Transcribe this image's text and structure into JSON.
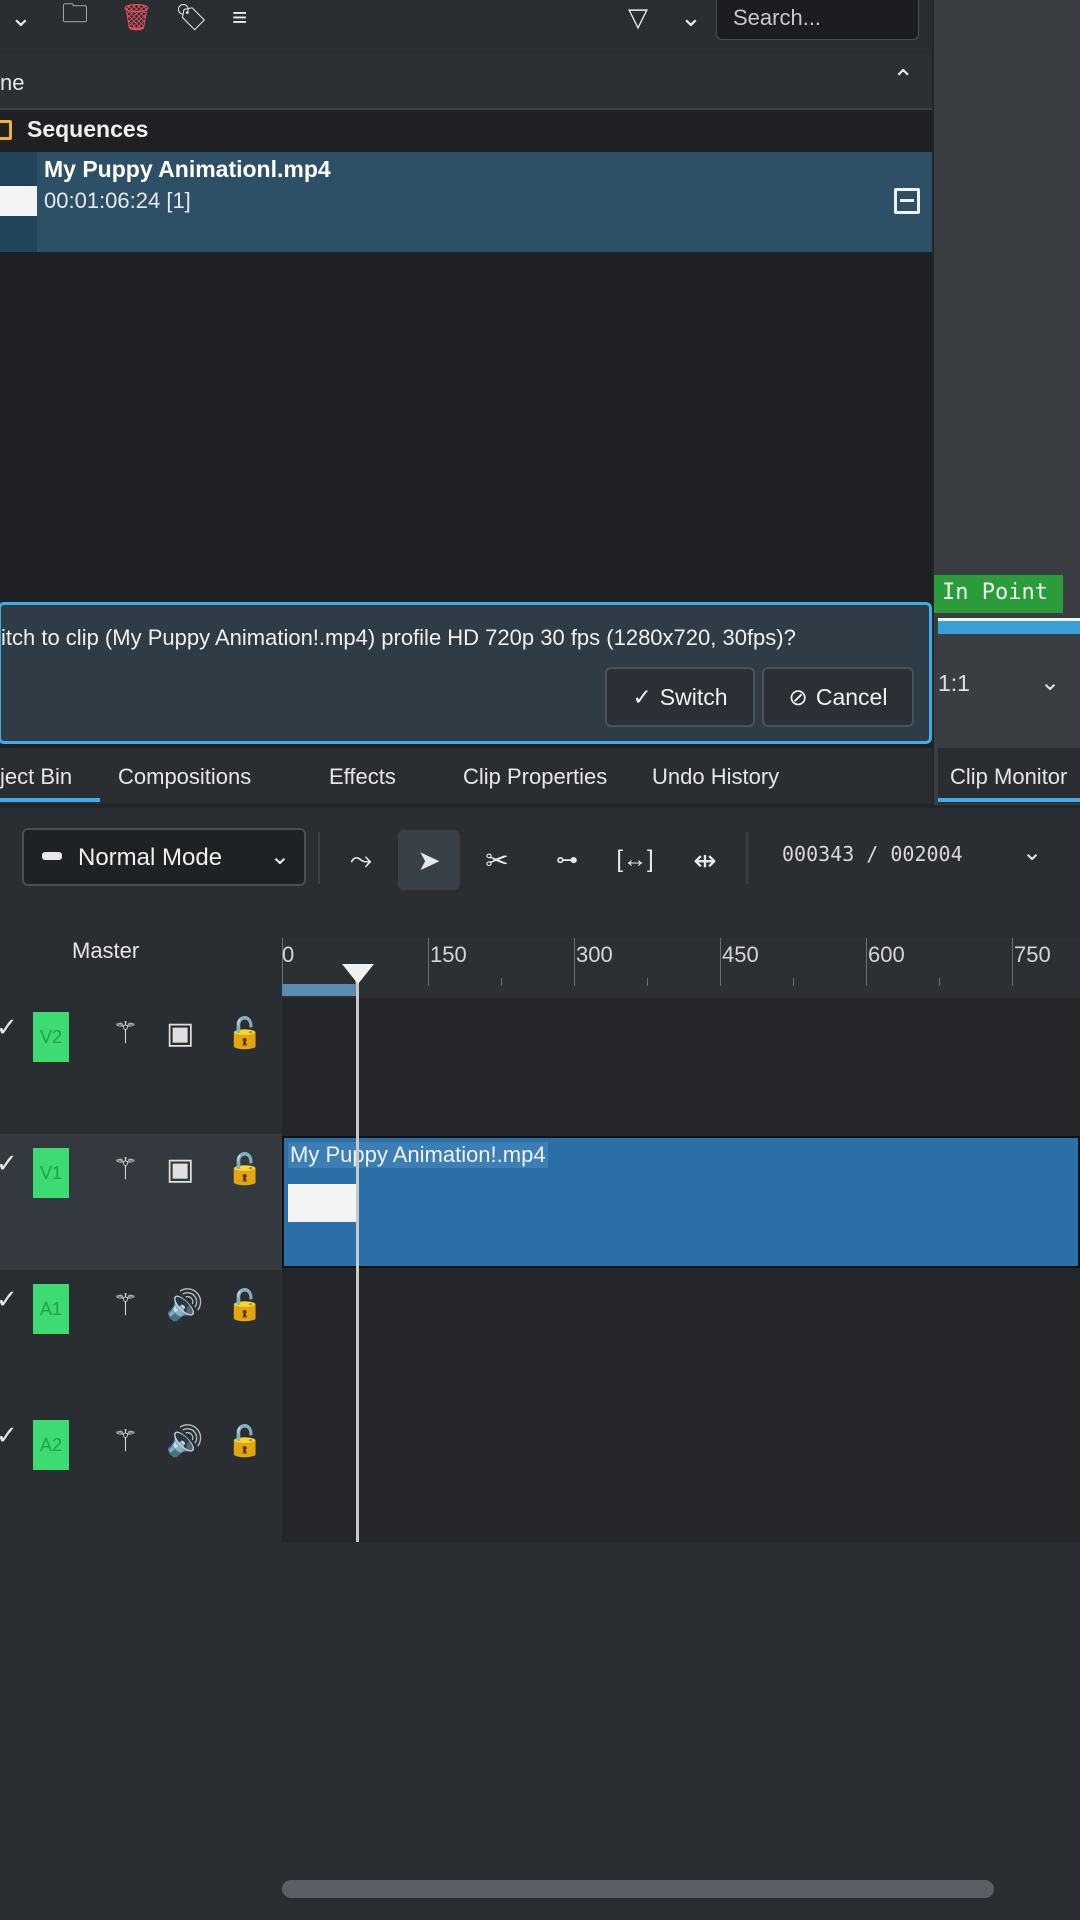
{
  "bin": {
    "search_placeholder": "Search...",
    "header_label": "ne",
    "folder_label": "Sequences",
    "clip": {
      "name": "My Puppy Animationl.mp4",
      "duration": "00:01:06:24 [1]"
    }
  },
  "monitor": {
    "in_point": "In Point",
    "zoom": "1:1",
    "tab_label": "Clip Monitor"
  },
  "banner": {
    "message": "itch to clip (My Puppy Animation!.mp4) profile HD 720p 30 fps (1280x720, 30fps)?",
    "switch_label": "Switch",
    "cancel_label": "Cancel"
  },
  "tabs": [
    {
      "label": "ject Bin"
    },
    {
      "label": "Compositions"
    },
    {
      "label": "Effects"
    },
    {
      "label": "Clip Properties"
    },
    {
      "label": "Undo History"
    }
  ],
  "timeline": {
    "mode": "Normal Mode",
    "timecode": "000343 / 002004",
    "master_label": "Master",
    "ruler": [
      "0",
      "150",
      "300",
      "450",
      "600",
      "750"
    ],
    "tracks": [
      {
        "tag": "V2",
        "kind": "video"
      },
      {
        "tag": "V1",
        "kind": "video"
      },
      {
        "tag": "A1",
        "kind": "audio"
      },
      {
        "tag": "A2",
        "kind": "audio"
      }
    ],
    "clip_name": "My Puppy Animation!.mp4"
  },
  "colors": {
    "accent": "#3daee9",
    "track_tag": "#3ddb72",
    "clip": "#2a6fa8",
    "in_point": "#2a9d3a"
  }
}
